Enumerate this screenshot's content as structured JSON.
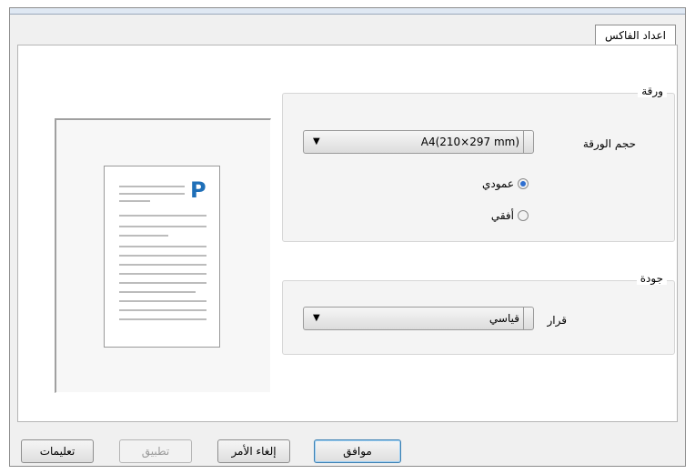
{
  "tab": {
    "label": "اعداد الفاكس"
  },
  "paper_group": {
    "title": "ورقة",
    "size_label": "حجم الورقة",
    "size_value": "A4(210×297 mm)",
    "orientation": [
      {
        "label": "عمودي",
        "checked": true
      },
      {
        "label": "أفقي",
        "checked": false
      }
    ]
  },
  "quality_group": {
    "title": "جودة",
    "resolution_label": "قرار",
    "resolution_value": "قياسي"
  },
  "preview": {
    "letter": "P"
  },
  "buttons": {
    "ok": "موافق",
    "cancel": "إلغاء الأمر",
    "apply": "تطبيق",
    "help": "تعليمات"
  },
  "icons": {
    "dropdown": "chevron-down-icon"
  },
  "colors": {
    "radio_selected": "#2f6fd0",
    "default_button_border": "#3c7fb1"
  }
}
